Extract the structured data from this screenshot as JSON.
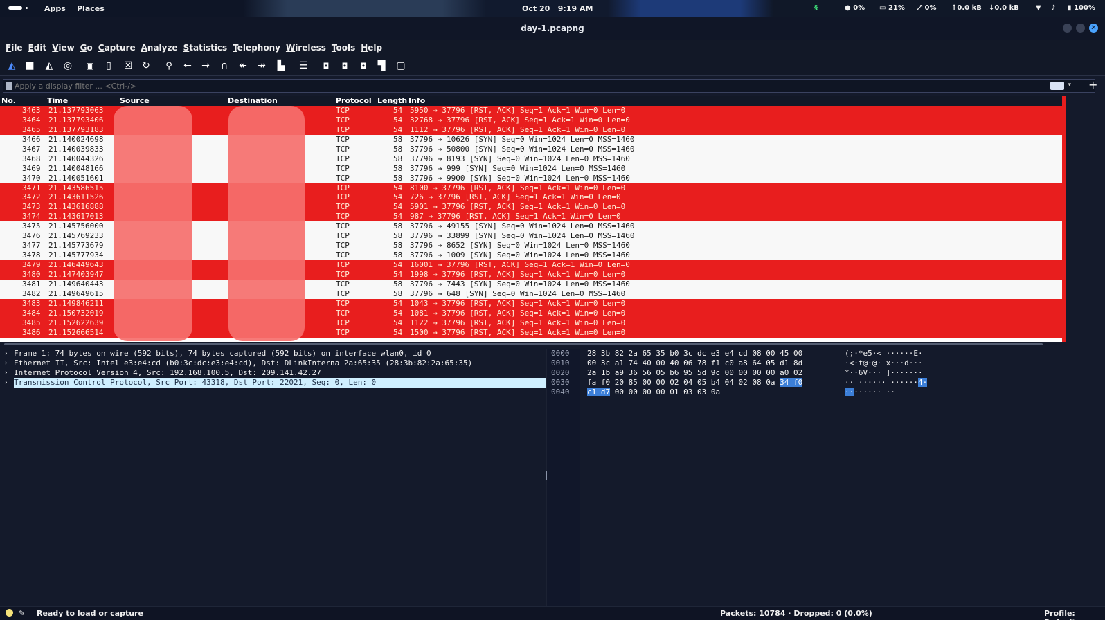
{
  "topbar": {
    "apps": "Apps",
    "places": "Places",
    "date": "Oct 20",
    "time": "9:19 AM",
    "tray": {
      "cpu": "0%",
      "mem": "21%",
      "swap": "0%",
      "upload": "0.0 kB",
      "download": "0.0 kB",
      "battery": "100%"
    }
  },
  "window": {
    "title": "day-1.pcapng"
  },
  "menu": [
    "File",
    "Edit",
    "View",
    "Go",
    "Capture",
    "Analyze",
    "Statistics",
    "Telephony",
    "Wireless",
    "Tools",
    "Help"
  ],
  "toolbar_icons": [
    "shark-start-icon",
    "stop-icon",
    "restart-icon",
    "options-icon",
    "open-icon",
    "save-icon",
    "close-file-icon",
    "reload-icon",
    "find-icon",
    "back-icon",
    "forward-icon",
    "go-to-icon",
    "first-icon",
    "last-icon",
    "autoscroll-icon",
    "colorize-icon",
    "zoom-in-icon",
    "zoom-out-icon",
    "zoom-reset-icon",
    "resize-columns-icon",
    "expand-icon"
  ],
  "filter": {
    "placeholder": "Apply a display filter ... <Ctrl-/>"
  },
  "columns": {
    "no": "No.",
    "time": "Time",
    "source": "Source",
    "destination": "Destination",
    "protocol": "Protocol",
    "length": "Length",
    "info": "Info"
  },
  "packets": [
    {
      "no": "3463",
      "time": "21.137793063",
      "proto": "TCP",
      "len": "54",
      "info": "5950 → 37796 [RST, ACK] Seq=1 Ack=1 Win=0 Len=0",
      "kind": "rst"
    },
    {
      "no": "3464",
      "time": "21.137793406",
      "proto": "TCP",
      "len": "54",
      "info": "32768 → 37796 [RST, ACK] Seq=1 Ack=1 Win=0 Len=0",
      "kind": "rst"
    },
    {
      "no": "3465",
      "time": "21.137793183",
      "proto": "TCP",
      "len": "54",
      "info": "1112 → 37796 [RST, ACK] Seq=1 Ack=1 Win=0 Len=0",
      "kind": "rst"
    },
    {
      "no": "3466",
      "time": "21.140024698",
      "proto": "TCP",
      "len": "58",
      "info": "37796 → 10626 [SYN] Seq=0 Win=1024 Len=0 MSS=1460",
      "kind": "syn"
    },
    {
      "no": "3467",
      "time": "21.140039833",
      "proto": "TCP",
      "len": "58",
      "info": "37796 → 50800 [SYN] Seq=0 Win=1024 Len=0 MSS=1460",
      "kind": "syn"
    },
    {
      "no": "3468",
      "time": "21.140044326",
      "proto": "TCP",
      "len": "58",
      "info": "37796 → 8193 [SYN] Seq=0 Win=1024 Len=0 MSS=1460",
      "kind": "syn"
    },
    {
      "no": "3469",
      "time": "21.140048166",
      "proto": "TCP",
      "len": "58",
      "info": "37796 → 999 [SYN] Seq=0 Win=1024 Len=0 MSS=1460",
      "kind": "syn"
    },
    {
      "no": "3470",
      "time": "21.140051601",
      "proto": "TCP",
      "len": "58",
      "info": "37796 → 9900 [SYN] Seq=0 Win=1024 Len=0 MSS=1460",
      "kind": "syn"
    },
    {
      "no": "3471",
      "time": "21.143586515",
      "proto": "TCP",
      "len": "54",
      "info": "8100 → 37796 [RST, ACK] Seq=1 Ack=1 Win=0 Len=0",
      "kind": "rst"
    },
    {
      "no": "3472",
      "time": "21.143611526",
      "proto": "TCP",
      "len": "54",
      "info": "726 → 37796 [RST, ACK] Seq=1 Ack=1 Win=0 Len=0",
      "kind": "rst"
    },
    {
      "no": "3473",
      "time": "21.143616888",
      "proto": "TCP",
      "len": "54",
      "info": "5901 → 37796 [RST, ACK] Seq=1 Ack=1 Win=0 Len=0",
      "kind": "rst"
    },
    {
      "no": "3474",
      "time": "21.143617013",
      "proto": "TCP",
      "len": "54",
      "info": "987 → 37796 [RST, ACK] Seq=1 Ack=1 Win=0 Len=0",
      "kind": "rst"
    },
    {
      "no": "3475",
      "time": "21.145756000",
      "proto": "TCP",
      "len": "58",
      "info": "37796 → 49155 [SYN] Seq=0 Win=1024 Len=0 MSS=1460",
      "kind": "syn"
    },
    {
      "no": "3476",
      "time": "21.145769233",
      "proto": "TCP",
      "len": "58",
      "info": "37796 → 33899 [SYN] Seq=0 Win=1024 Len=0 MSS=1460",
      "kind": "syn"
    },
    {
      "no": "3477",
      "time": "21.145773679",
      "proto": "TCP",
      "len": "58",
      "info": "37796 → 8652 [SYN] Seq=0 Win=1024 Len=0 MSS=1460",
      "kind": "syn"
    },
    {
      "no": "3478",
      "time": "21.145777934",
      "proto": "TCP",
      "len": "58",
      "info": "37796 → 1009 [SYN] Seq=0 Win=1024 Len=0 MSS=1460",
      "kind": "syn"
    },
    {
      "no": "3479",
      "time": "21.146449643",
      "proto": "TCP",
      "len": "54",
      "info": "16001 → 37796 [RST, ACK] Seq=1 Ack=1 Win=0 Len=0",
      "kind": "rst"
    },
    {
      "no": "3480",
      "time": "21.147403947",
      "proto": "TCP",
      "len": "54",
      "info": "1998 → 37796 [RST, ACK] Seq=1 Ack=1 Win=0 Len=0",
      "kind": "rst"
    },
    {
      "no": "3481",
      "time": "21.149640443",
      "proto": "TCP",
      "len": "58",
      "info": "37796 → 7443 [SYN] Seq=0 Win=1024 Len=0 MSS=1460",
      "kind": "syn"
    },
    {
      "no": "3482",
      "time": "21.149649615",
      "proto": "TCP",
      "len": "58",
      "info": "37796 → 648 [SYN] Seq=0 Win=1024 Len=0 MSS=1460",
      "kind": "syn"
    },
    {
      "no": "3483",
      "time": "21.149846211",
      "proto": "TCP",
      "len": "54",
      "info": "1043 → 37796 [RST, ACK] Seq=1 Ack=1 Win=0 Len=0",
      "kind": "rst"
    },
    {
      "no": "3484",
      "time": "21.150732019",
      "proto": "TCP",
      "len": "54",
      "info": "1081 → 37796 [RST, ACK] Seq=1 Ack=1 Win=0 Len=0",
      "kind": "rst"
    },
    {
      "no": "3485",
      "time": "21.152622639",
      "proto": "TCP",
      "len": "54",
      "info": "1122 → 37796 [RST, ACK] Seq=1 Ack=1 Win=0 Len=0",
      "kind": "rst"
    },
    {
      "no": "3486",
      "time": "21.152666514",
      "proto": "TCP",
      "len": "54",
      "info": "1500 → 37796 [RST, ACK] Seq=1 Ack=1 Win=0 Len=0",
      "kind": "rst"
    }
  ],
  "details": [
    {
      "text": "Frame 1: 74 bytes on wire (592 bits), 74 bytes captured (592 bits) on interface wlan0, id 0",
      "selected": false
    },
    {
      "text": "Ethernet II, Src: Intel_e3:e4:cd (b0:3c:dc:e3:e4:cd), Dst: DLinkInterna_2a:65:35 (28:3b:82:2a:65:35)",
      "selected": false
    },
    {
      "text": "Internet Protocol Version 4, Src: 192.168.100.5, Dst: 209.141.42.27",
      "selected": false
    },
    {
      "text": "Transmission Control Protocol, Src Port: 43318, Dst Port: 22021, Seq: 0, Len: 0",
      "selected": true
    }
  ],
  "bytes": [
    {
      "off": "0000",
      "hex": "28 3b 82 2a 65 35 b0 3c  dc e3 e4 cd 08 00 45 00",
      "hex_hl": "",
      "ascii": "(;·*e5·<  ······E·",
      "ascii_hl": ""
    },
    {
      "off": "0010",
      "hex": "00 3c a1 74 40 00 40 06  78 f1 c0 a8 64 05 d1 8d",
      "hex_hl": "",
      "ascii": "·<·t@·@·  x···d···",
      "ascii_hl": ""
    },
    {
      "off": "0020",
      "hex": "2a 1b a9 36 56 05 b6 95  5d 9c 00 00 00 00 a0 02",
      "hex_hl": "",
      "ascii": "*··6V···  ]·······",
      "ascii_hl": ""
    },
    {
      "off": "0030",
      "hex": "fa f0 20 85 00 00 02 04  05 b4 04 02 08 0a ",
      "hex_hl": "34 f0",
      "ascii": "·· ······  ······",
      "ascii_hl": "4·"
    },
    {
      "off": "0040",
      "hex": "",
      "hex_hl": "c1 d7",
      "hex_rest": " 00 00 00 00 01 03  03 0a",
      "ascii": "",
      "ascii_hl": "··",
      "ascii_rest": "······ ··"
    }
  ],
  "status": {
    "ready": "Ready to load or capture",
    "packets": "Packets: 10784 · Dropped: 0 (0.0%)",
    "profile": "Profile: Default"
  },
  "colors": {
    "rst_row": "#e81e1e",
    "syn_row": "#f8f8f8",
    "selection": "#cfefff"
  }
}
